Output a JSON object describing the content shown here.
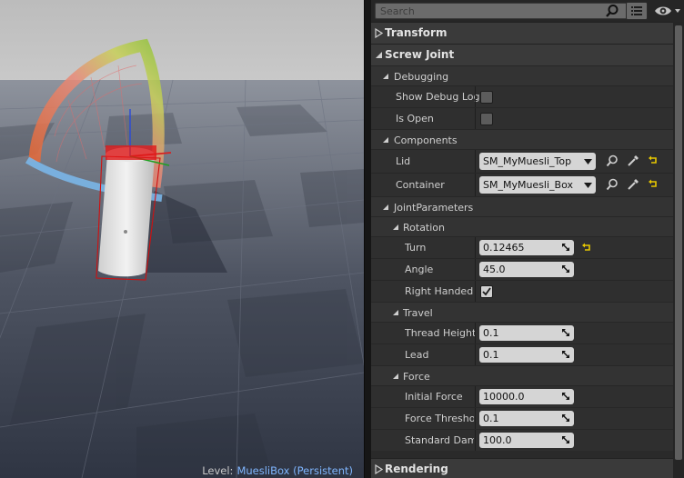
{
  "viewport": {
    "level_prefix": "Level:",
    "level_name": "MuesliBox (Persistent)"
  },
  "details": {
    "search": {
      "placeholder": "Search",
      "value": ""
    },
    "categories": {
      "transform": "Transform",
      "screw_joint": "Screw Joint",
      "rendering": "Rendering"
    },
    "groups": {
      "debugging": "Debugging",
      "components": "Components",
      "joint_parameters": "JointParameters",
      "rotation": "Rotation",
      "travel": "Travel",
      "force": "Force"
    },
    "props": {
      "show_debug_log": {
        "label": "Show Debug Log",
        "checked": false
      },
      "is_open": {
        "label": "Is Open",
        "checked": false
      },
      "lid": {
        "label": "Lid",
        "value": "SM_MyMuesli_Top"
      },
      "container": {
        "label": "Container",
        "value": "SM_MyMuesli_Box"
      },
      "turn": {
        "label": "Turn",
        "value": "0.12465"
      },
      "angle": {
        "label": "Angle",
        "value": "45.0"
      },
      "right_handed": {
        "label": "Right Handed",
        "checked": true
      },
      "thread_height": {
        "label": "Thread Height",
        "value": "0.1"
      },
      "lead": {
        "label": "Lead",
        "value": "0.1"
      },
      "initial_force": {
        "label": "Initial Force",
        "value": "10000.0"
      },
      "force_threshold": {
        "label": "Force Threshold",
        "value": "0.1"
      },
      "standard_damping": {
        "label": "Standard Damping",
        "value": "100.0"
      }
    },
    "icons": {
      "browse": "magnifier-icon",
      "use_selected": "eyedropper-icon",
      "reset": "reset-arrow-icon"
    },
    "colors": {
      "panel_bg": "#2e2e2e",
      "category_bg": "#3a3a3a",
      "field_bg": "#d5d5d5",
      "reset_arrow": "#e8c800",
      "level_name": "#7fb6ff"
    }
  }
}
